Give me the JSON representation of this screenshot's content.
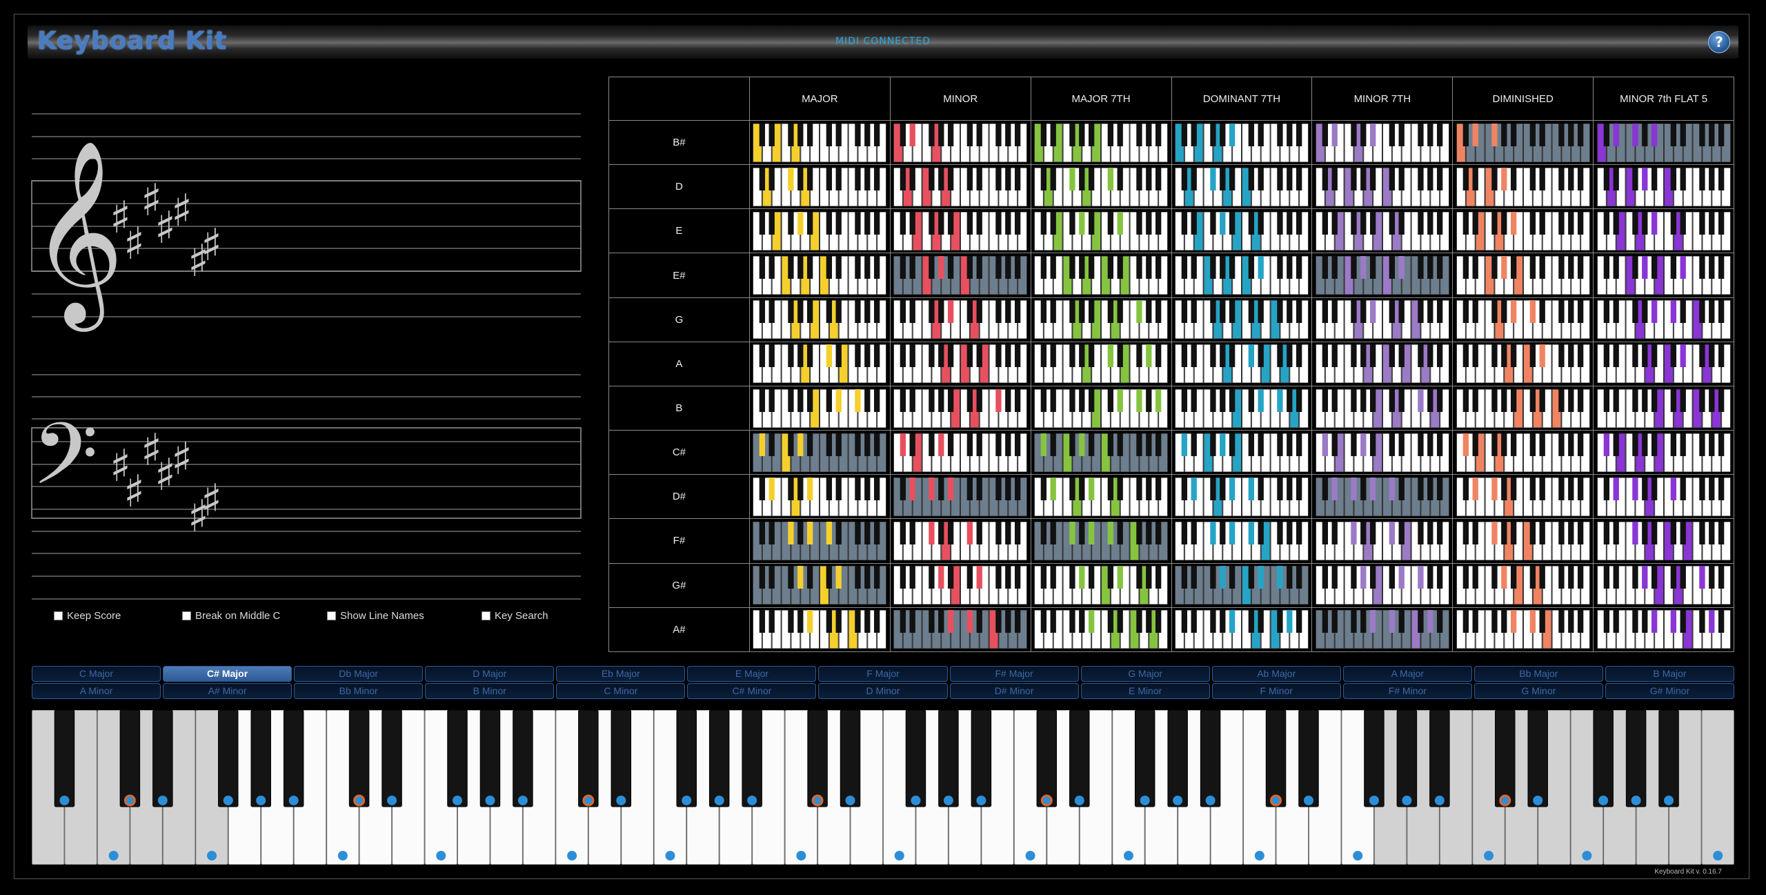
{
  "app": {
    "title": "Keyboard Kit",
    "midi_status": "MIDI CONNECTED",
    "help_label": "?",
    "version": "Keyboard Kit v. 0.16.7"
  },
  "staff": {
    "treble_clef": "𝄞",
    "bass_clef": "𝄢",
    "sharp_glyph": "♯",
    "key_signature_sharps": 7
  },
  "options": [
    {
      "label": "Keep Score",
      "checked": false
    },
    {
      "label": "Break on Middle C",
      "checked": false
    },
    {
      "label": "Show Line Names",
      "checked": false
    },
    {
      "label": "Key Search",
      "checked": false
    }
  ],
  "chord_grid": {
    "columns": [
      {
        "label": "MAJOR",
        "color": "#f5d02c",
        "intervals": [
          0,
          4,
          7
        ]
      },
      {
        "label": "MINOR",
        "color": "#e8505f",
        "intervals": [
          0,
          3,
          7
        ]
      },
      {
        "label": "MAJOR 7TH",
        "color": "#86c440",
        "intervals": [
          0,
          4,
          7,
          11
        ]
      },
      {
        "label": "DOMINANT 7TH",
        "color": "#26a4c6",
        "intervals": [
          0,
          4,
          7,
          10
        ]
      },
      {
        "label": "MINOR 7TH",
        "color": "#9b7ac6",
        "intervals": [
          0,
          3,
          7,
          10
        ]
      },
      {
        "label": "DIMINISHED",
        "color": "#f08462",
        "intervals": [
          0,
          3,
          6
        ]
      },
      {
        "label": "MINOR 7th FLAT 5",
        "color": "#8a35d6",
        "intervals": [
          0,
          3,
          6,
          10
        ]
      }
    ],
    "rows": [
      {
        "label": "B#",
        "root": 0
      },
      {
        "label": "D",
        "root": 2
      },
      {
        "label": "E",
        "root": 4
      },
      {
        "label": "E#",
        "root": 5
      },
      {
        "label": "G",
        "root": 7
      },
      {
        "label": "A",
        "root": 9
      },
      {
        "label": "B",
        "root": 11
      },
      {
        "label": "C#",
        "root": 1
      },
      {
        "label": "D#",
        "root": 3
      },
      {
        "label": "F#",
        "root": 6
      },
      {
        "label": "G#",
        "root": 8
      },
      {
        "label": "A#",
        "root": 10
      }
    ],
    "highlighted_cells": [
      [
        0,
        5
      ],
      [
        0,
        6
      ],
      [
        3,
        1
      ],
      [
        3,
        4
      ],
      [
        7,
        0
      ],
      [
        7,
        2
      ],
      [
        8,
        1
      ],
      [
        8,
        4
      ],
      [
        9,
        0
      ],
      [
        9,
        2
      ],
      [
        10,
        0
      ],
      [
        10,
        3
      ],
      [
        11,
        1
      ],
      [
        11,
        4
      ]
    ],
    "highlight_bg": "#6d7e8e"
  },
  "key_selector": {
    "majors": [
      "C Major",
      "C# Major",
      "Db Major",
      "D Major",
      "Eb Major",
      "E Major",
      "F Major",
      "F# Major",
      "G Major",
      "Ab Major",
      "A Major",
      "Bb Major",
      "B Major"
    ],
    "minors": [
      "A Minor",
      "A# Minor",
      "Bb Minor",
      "B Minor",
      "C Minor",
      "C# Minor",
      "D Minor",
      "D# Minor",
      "E Minor",
      "F Minor",
      "F# Minor",
      "G Minor",
      "G# Minor"
    ],
    "selected": "C# Major"
  },
  "piano": {
    "white_keys": 52,
    "first_white_note": "A",
    "dimmed_white_ranges": [
      [
        0,
        5
      ],
      [
        41,
        51
      ]
    ],
    "key_marker_color": "#2d8ed8",
    "tonic_marker_color": "#e0662a",
    "tonic_pitch_class": 1
  }
}
